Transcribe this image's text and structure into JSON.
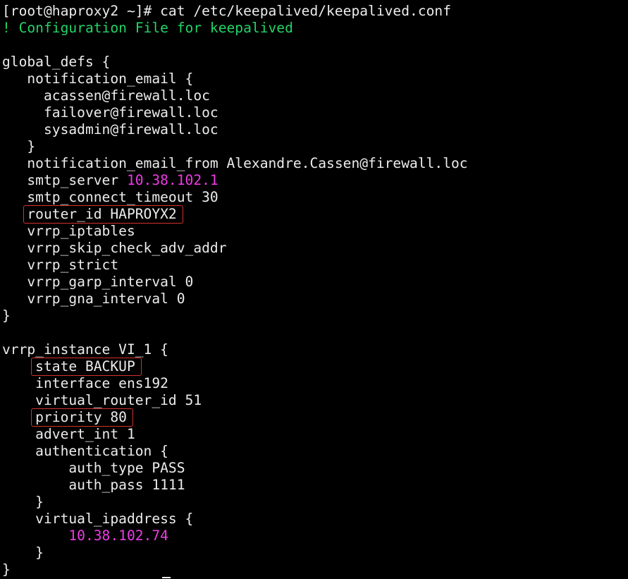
{
  "terminal": {
    "lines": [
      [
        {
          "text": "[root@haproxy2 ~]# cat /etc/keepalived/keepalived.conf",
          "style": "plain"
        }
      ],
      [
        {
          "text": "! Configuration File for keepalived",
          "style": "comment"
        }
      ],
      [],
      [
        {
          "text": "global_defs {",
          "style": "plain"
        }
      ],
      [
        {
          "text": "   notification_email {",
          "style": "plain"
        }
      ],
      [
        {
          "text": "     acassen@firewall.loc",
          "style": "plain"
        }
      ],
      [
        {
          "text": "     failover@firewall.loc",
          "style": "plain"
        }
      ],
      [
        {
          "text": "     sysadmin@firewall.loc",
          "style": "plain"
        }
      ],
      [
        {
          "text": "   }",
          "style": "plain"
        }
      ],
      [
        {
          "text": "   notification_email_from Alexandre.Cassen@firewall.loc",
          "style": "plain"
        }
      ],
      [
        {
          "text": "   smtp_server ",
          "style": "plain"
        },
        {
          "text": "10.38.102.1",
          "style": "ip"
        }
      ],
      [
        {
          "text": "   smtp_connect_timeout 30",
          "style": "plain"
        }
      ],
      [
        {
          "text": "   router_id HAPROYX2",
          "style": "plain"
        }
      ],
      [
        {
          "text": "   vrrp_iptables",
          "style": "plain"
        }
      ],
      [
        {
          "text": "   vrrp_skip_check_adv_addr",
          "style": "plain"
        }
      ],
      [
        {
          "text": "   vrrp_strict",
          "style": "plain"
        }
      ],
      [
        {
          "text": "   vrrp_garp_interval 0",
          "style": "plain"
        }
      ],
      [
        {
          "text": "   vrrp_gna_interval 0",
          "style": "plain"
        }
      ],
      [
        {
          "text": "}",
          "style": "plain"
        }
      ],
      [],
      [
        {
          "text": "vrrp_instance VI_1 {",
          "style": "plain"
        }
      ],
      [
        {
          "text": "    state BACKUP",
          "style": "plain"
        }
      ],
      [
        {
          "text": "    interface ens192",
          "style": "plain"
        }
      ],
      [
        {
          "text": "    virtual_router_id 51",
          "style": "plain"
        }
      ],
      [
        {
          "text": "    priority 80",
          "style": "plain"
        }
      ],
      [
        {
          "text": "    advert_int 1",
          "style": "plain"
        }
      ],
      [
        {
          "text": "    authentication {",
          "style": "plain"
        }
      ],
      [
        {
          "text": "        auth_type PASS",
          "style": "plain"
        }
      ],
      [
        {
          "text": "        auth_pass 1111",
          "style": "plain"
        }
      ],
      [
        {
          "text": "    }",
          "style": "plain"
        }
      ],
      [
        {
          "text": "    virtual_ipaddress {",
          "style": "plain"
        }
      ],
      [
        {
          "text": "        ",
          "style": "plain"
        },
        {
          "text": "10.38.102.74",
          "style": "ip"
        }
      ],
      [
        {
          "text": "    }",
          "style": "plain"
        }
      ],
      [
        {
          "text": "}",
          "style": "plain"
        }
      ]
    ],
    "highlighted_lines": [
      12,
      21,
      24
    ]
  },
  "colors": {
    "background": "#000000",
    "text": "#ececec",
    "comment": "#22d468",
    "ip_address": "#ee3be6",
    "highlight_box": "#d4322c"
  }
}
